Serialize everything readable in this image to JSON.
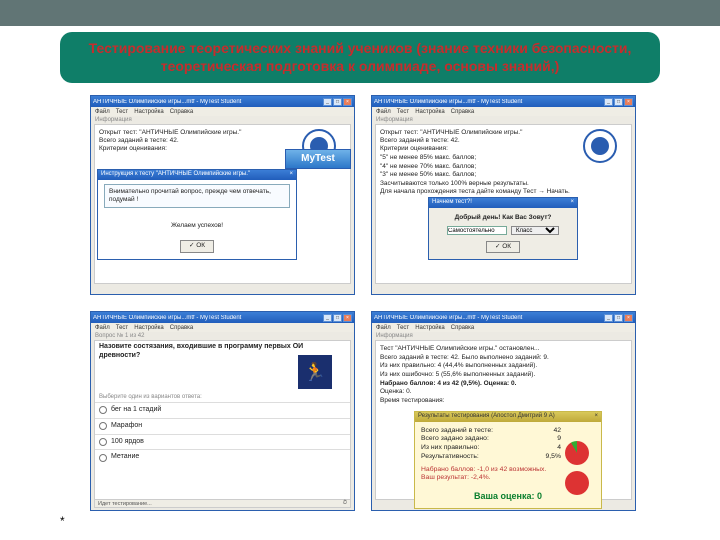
{
  "slide": {
    "title": "Тестирование теоретических знаний учеников (знание техники безопасности, теоретическая подготовка к олимпиаде, основы знаний,)",
    "star": "*"
  },
  "common": {
    "app_title": "АНТИЧНЫЕ Олимпийские игры...mtf - MyTest Student",
    "menu": {
      "file": "Файл",
      "test": "Тест",
      "settings": "Настройка",
      "help": "Справка"
    },
    "winbtns": {
      "min": "_",
      "max": "□",
      "close": "×"
    },
    "pane_info": "Информация",
    "ok": "✓ ОК",
    "mytest": "MyTest"
  },
  "w1": {
    "open": "Открыт тест: \"АНТИЧНЫЕ Олимпийские игры.\"",
    "total": "Всего заданий в тесте: 42.",
    "crit": "Критерии оценивания:",
    "instr_title": "Инструкция к тесту \"АНТИЧНЫЕ Олимпийские игры.\"",
    "instr_close": "×",
    "instr1": "Внимательно прочитай вопрос, прежде чем отвечать, подумай !",
    "instr2": "Желаем успехов!"
  },
  "w2": {
    "open": "Открыт тест: \"АНТИЧНЫЕ Олимпийские игры.\"",
    "total": "Всего заданий в тесте: 42.",
    "crit": "Критерии оценивания:",
    "c1": "\"5\" не менее 85% макс. баллов;",
    "c2": "\"4\" не менее 70% макс. баллов;",
    "c3": "\"3\" не менее 50% макс. баллов;",
    "c4": "Засчитываются только 100% верные результаты.",
    "c5": "Для начала прохождения теста дайте команду Тест → Начать.",
    "dlg_title": "Начнем тест?!",
    "dlg_close": "×",
    "dlg_prompt": "Добрый день! Как Вас Зовут?",
    "dlg_name": "Самостоятельно",
    "dlg_class": "Класс"
  },
  "w3": {
    "counter": "Вопрос № 1 из 42",
    "question": "Назовите состязания, входившие в программу первых ОИ древности?",
    "icon": "🏃",
    "o1": "бег на 1 стадий",
    "o2": "Марафон",
    "o3": "100 ярдов",
    "o4": "Метание",
    "status": "Идет тестирование..."
  },
  "w4": {
    "l1": "Тест \"АНТИЧНЫЕ Олимпийские игры.\" остановлен...",
    "l2": "Всего заданий в тесте: 42. Было выполнено заданий: 9.",
    "l3": "Из них правильно: 4 (44,4% выполненных заданий).",
    "l4": "Из них ошибочно: 5 (55,6% выполненных заданий).",
    "l5": "Набрано баллов: 4 из 42 (9,5%). Оценка: 0.",
    "l6": "Оценка: 0.",
    "l7": "Время тестирования:",
    "res_title": "Результаты тестирования (Апостол Дмитрий 9 А)",
    "res_close": "×",
    "r1l": "Всего заданий в тесте:",
    "r1v": "42",
    "r2l": "Всего задано задано:",
    "r2v": "9",
    "r3l": "Из них правильно:",
    "r3v": "4",
    "r4l": "Результативность:",
    "r4v": "9,5%",
    "picked": "Набрано баллов: -1,0 из 42 возможных.",
    "your": "Ваш результат: -2,4%.",
    "grade": "Ваша оценка: 0"
  }
}
